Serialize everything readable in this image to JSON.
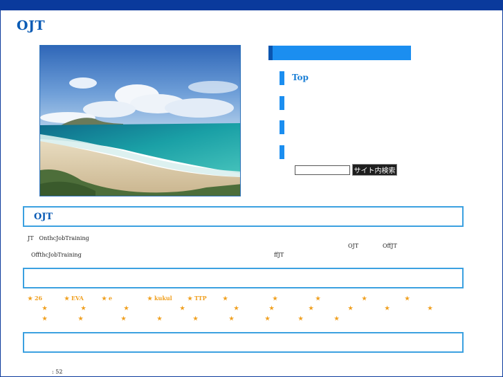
{
  "site": {
    "title": "OJT"
  },
  "nav": {
    "items": [
      {
        "label": "Top"
      },
      {
        "label": ""
      },
      {
        "label": ""
      },
      {
        "label": ""
      }
    ],
    "search": {
      "placeholder": "",
      "button_label": "サイト内検索"
    }
  },
  "section_ojt": {
    "title": "OJT",
    "lines": {
      "line1": "JT　OnthcJobTraining",
      "ojt_word": "OJT",
      "offjt_word": "OffJT",
      "line3_left": "OffthcJobTraining",
      "line3_mid": "ffJT"
    }
  },
  "section_links": {
    "title": "",
    "row1": [
      "★ 26",
      "★ EVA",
      "★ e",
      "★ kukul",
      "★ TTP",
      "★",
      "★",
      "★",
      "★",
      "★"
    ],
    "row2": [
      "★",
      "★",
      "★",
      "★",
      "★",
      "★",
      "★",
      "★",
      "★",
      "★"
    ],
    "row3": [
      "★",
      "★",
      "★",
      "★",
      "★",
      "★",
      "★",
      "★",
      "★"
    ]
  },
  "section_bottom": {
    "title": ""
  },
  "footer": {
    "counter": ": 52"
  },
  "colors": {
    "brand_dark": "#0a3a9c",
    "accent": "#1b8ef0",
    "star": "#f0a020"
  },
  "icons": {
    "nav_marker": "bar-marker-icon"
  }
}
